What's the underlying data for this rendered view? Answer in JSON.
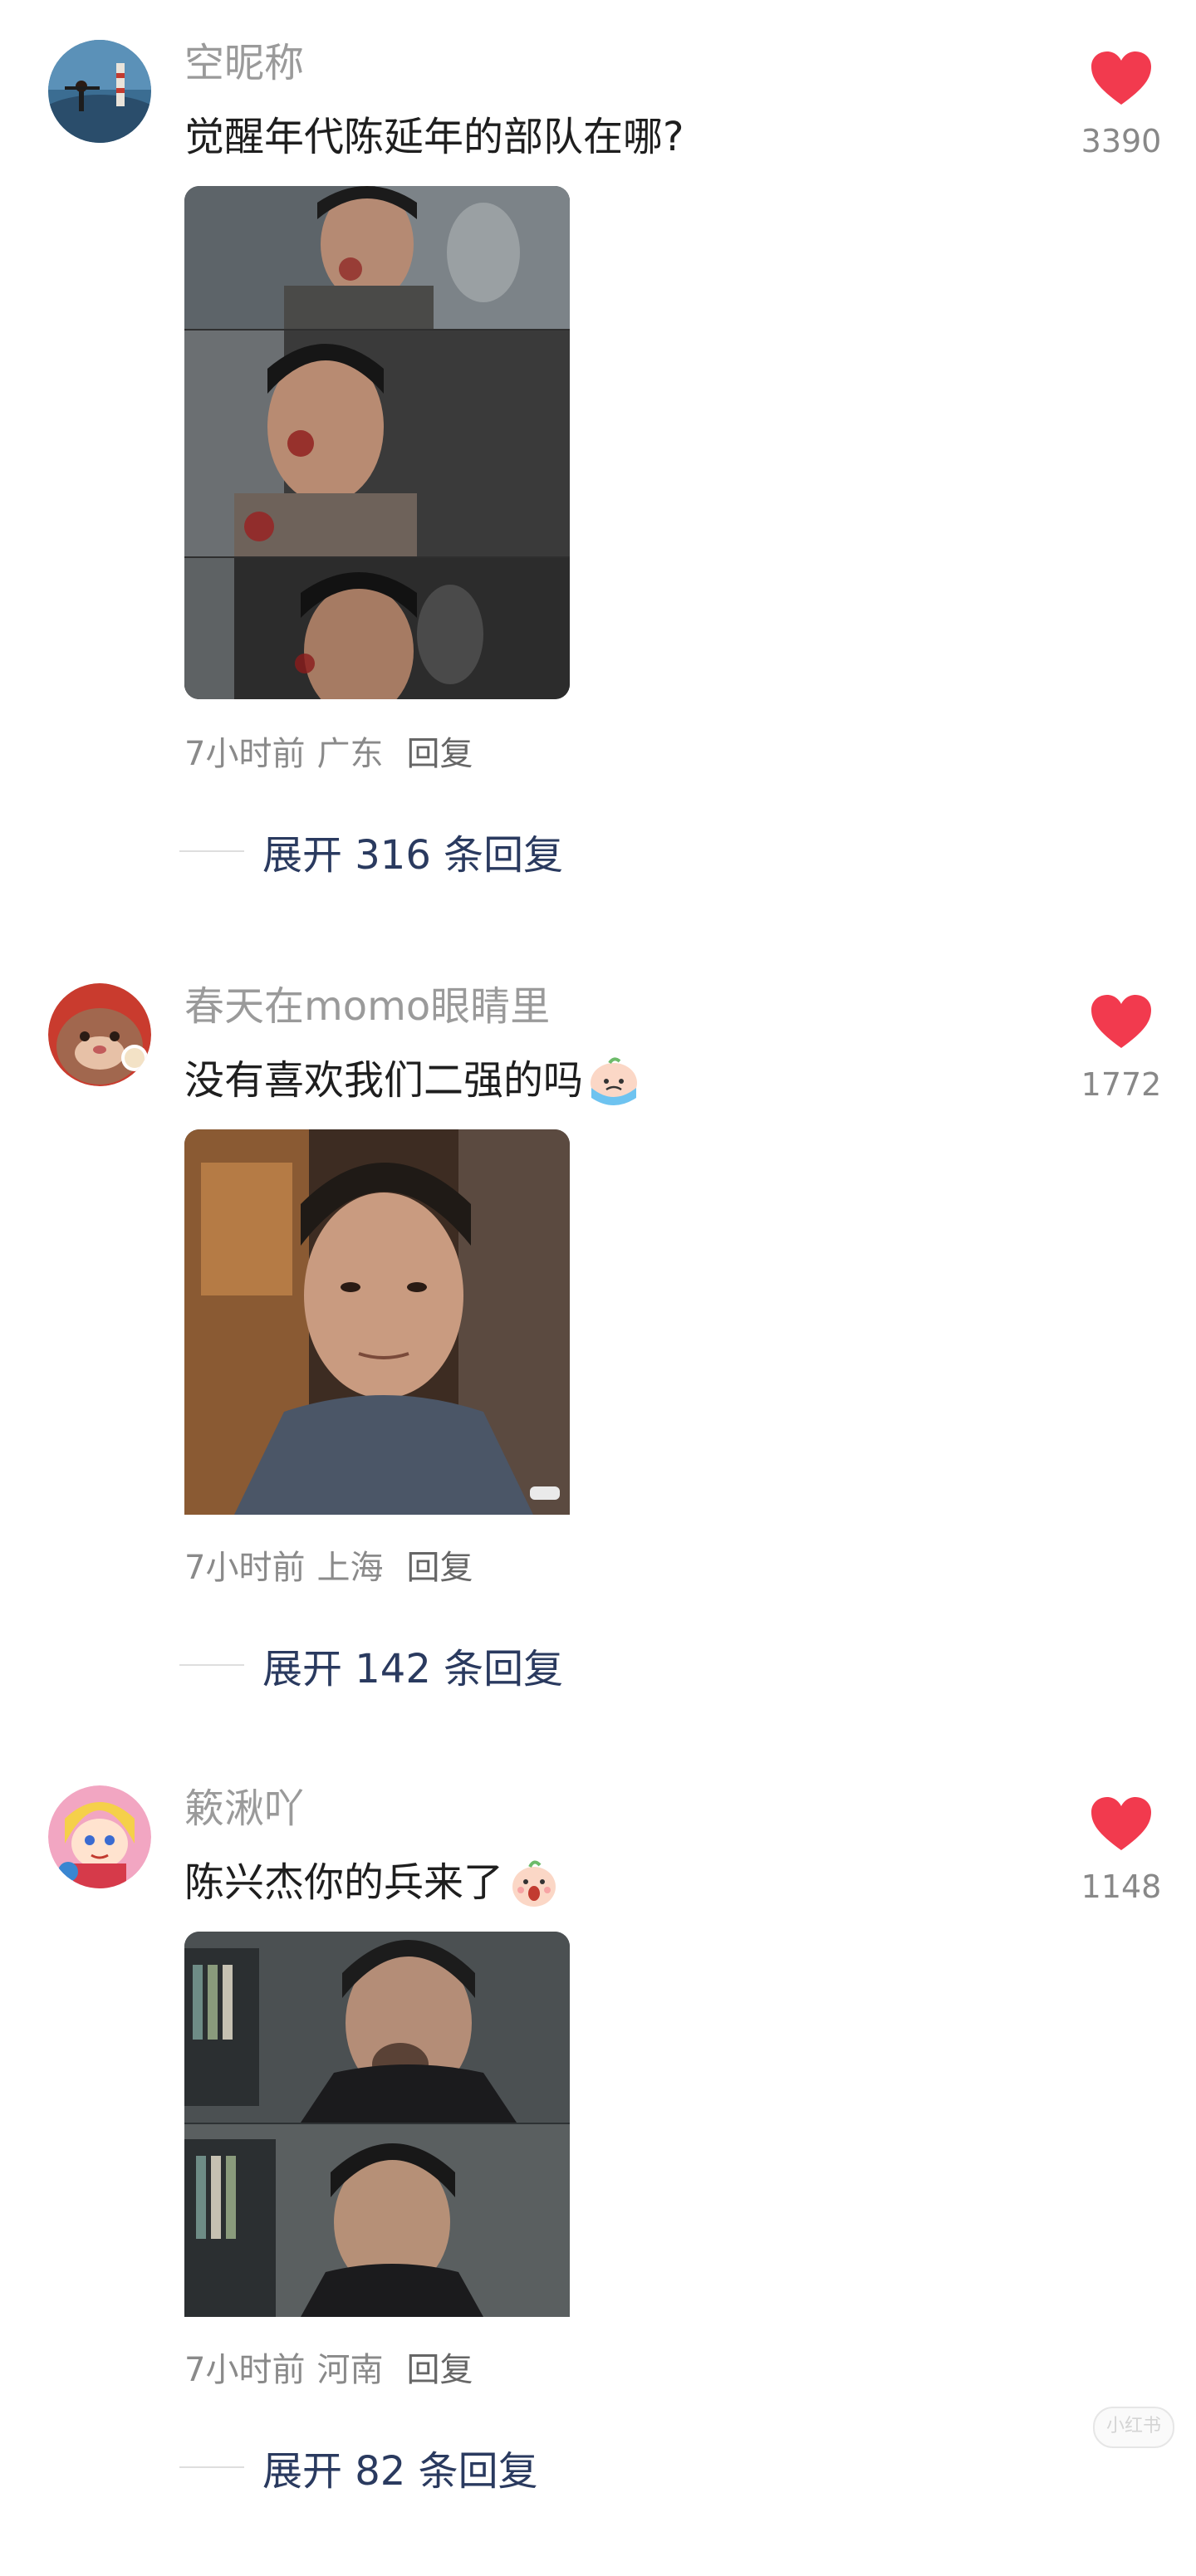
{
  "comments": [
    {
      "username": "空昵称",
      "text": "觉醒年代陈延年的部队在哪?",
      "has_emoji": false,
      "like_count": "3390",
      "meta": {
        "time": "7小时前",
        "location": "广东",
        "reply": "回复"
      },
      "expand": "展开 316 条回复",
      "avatar_icon": "lighthouse-avatar",
      "image_desc": "three-panel-still"
    },
    {
      "username": "春天在momo眼睛里",
      "text": "没有喜欢我们二强的吗",
      "has_emoji": true,
      "emoji_icon": "crying-face-emoji",
      "like_count": "1772",
      "meta": {
        "time": "7小时前",
        "location": "上海",
        "reply": "回复"
      },
      "expand": "展开 142 条回复",
      "avatar_icon": "cartoon-avatar",
      "image_desc": "single-portrait-still"
    },
    {
      "username": "簌湫吖",
      "text": "陈兴杰你的兵来了",
      "has_emoji": true,
      "emoji_icon": "surprised-face-emoji",
      "like_count": "1148",
      "meta": {
        "time": "7小时前",
        "location": "河南",
        "reply": "回复"
      },
      "expand": "展开 82 条回复",
      "avatar_icon": "anime-avatar",
      "image_desc": "two-panel-still"
    }
  ],
  "watermark": "小红书",
  "colors": {
    "like_heart": "#f23a4e",
    "username": "#9a9a9a",
    "expand_text": "#2a3a5f",
    "body_text": "#1e1e1e"
  }
}
